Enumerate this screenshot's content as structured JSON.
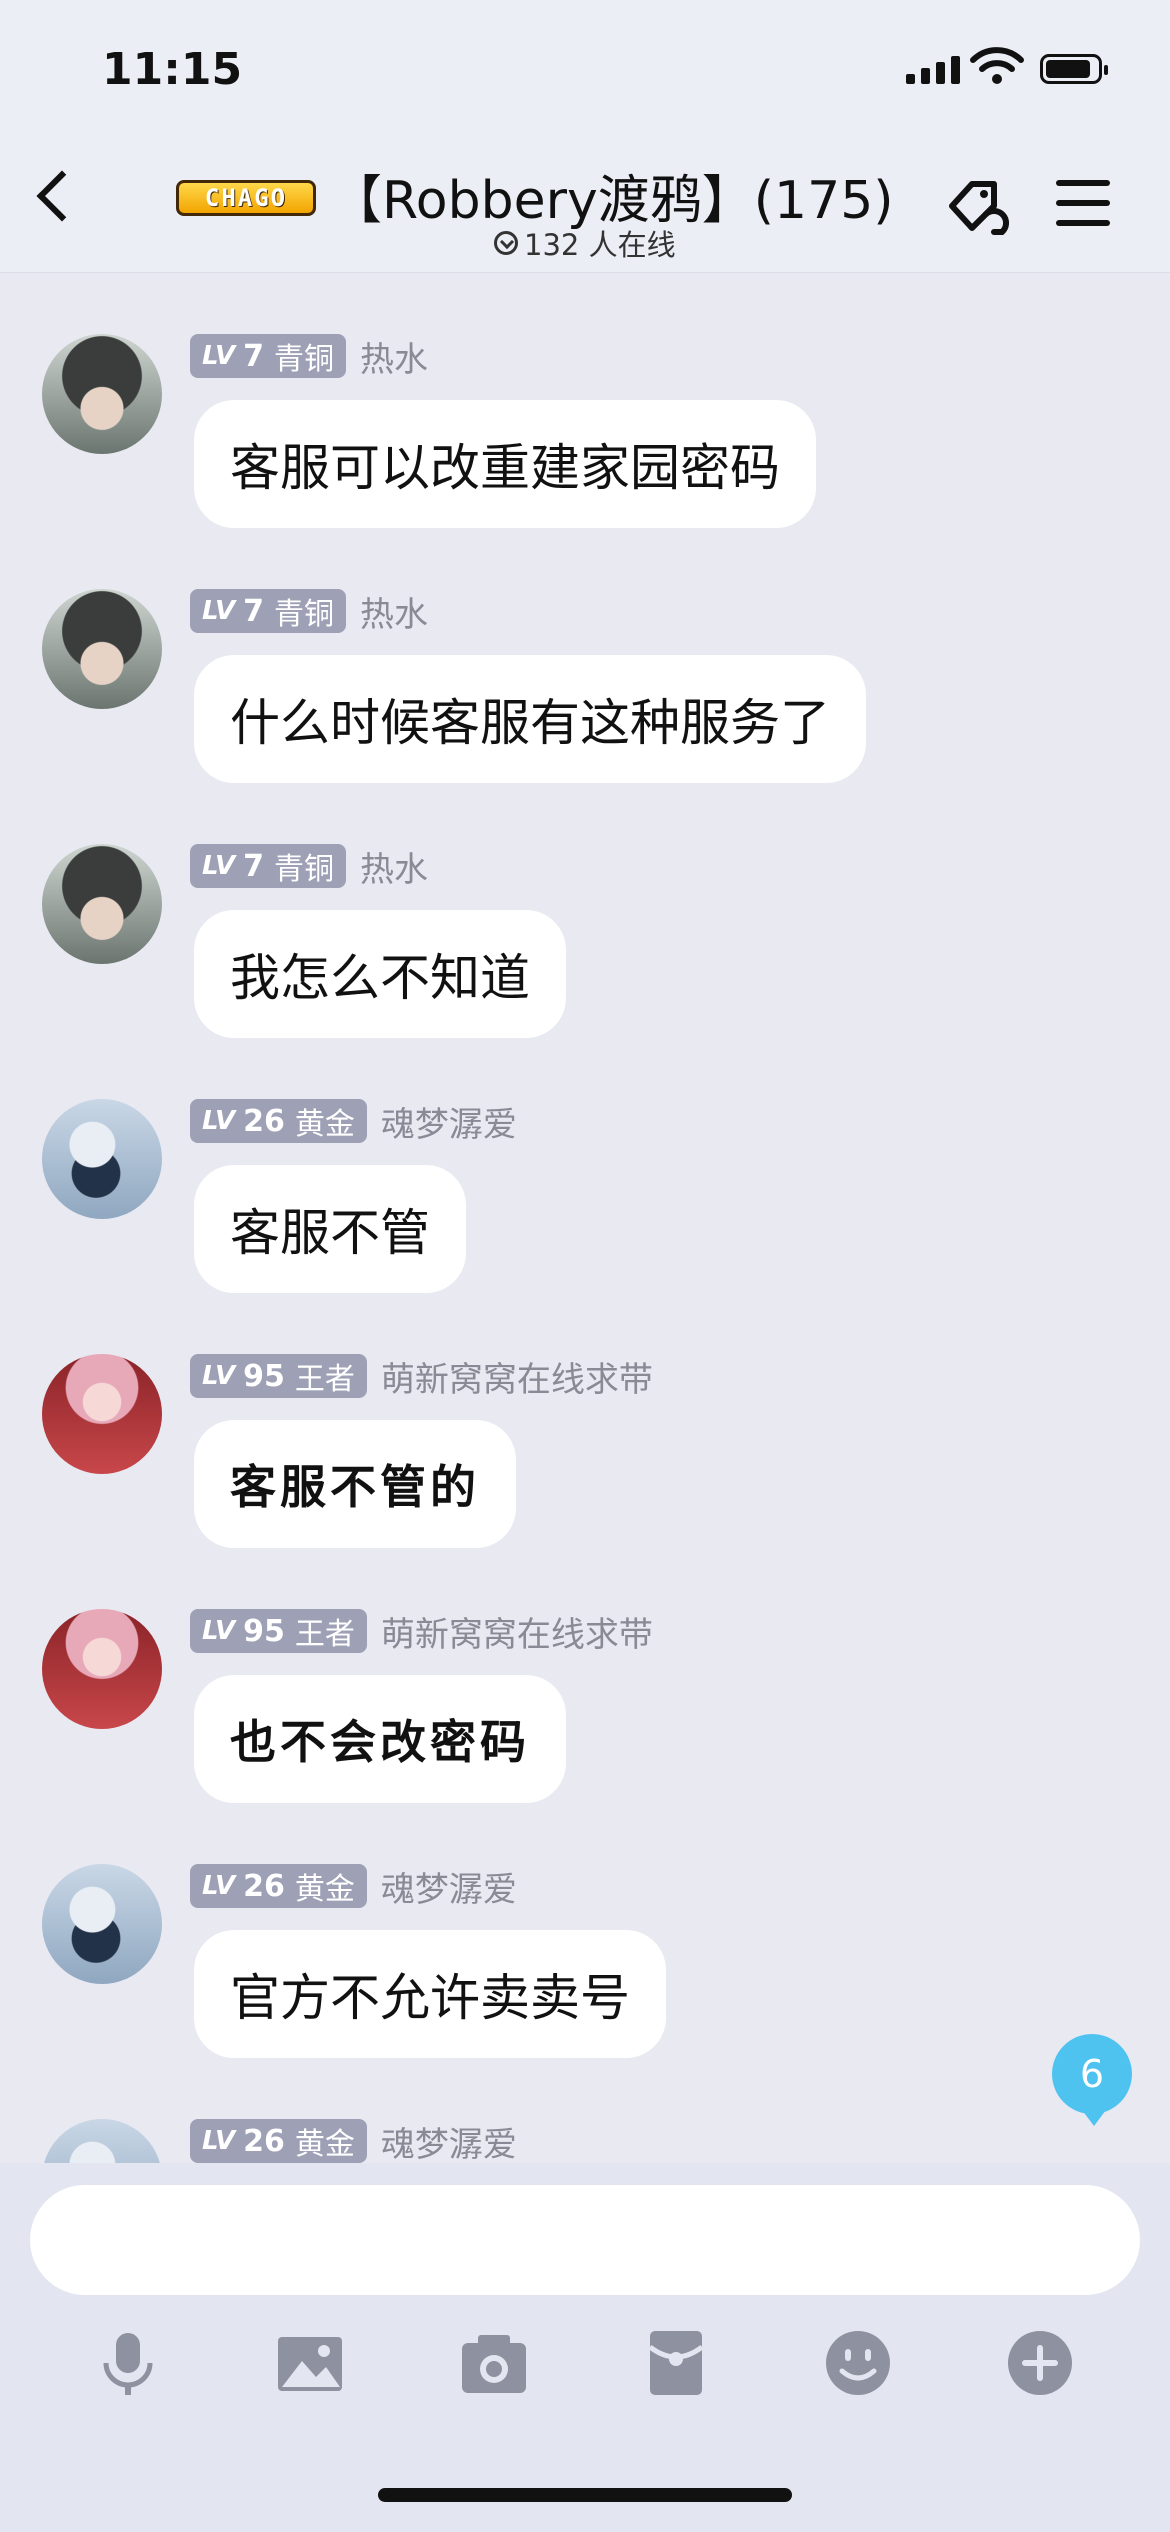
{
  "status_bar": {
    "time": "11:15"
  },
  "header": {
    "logo_text": "CHAGO",
    "title": "【Robbery渡鸦】(175)",
    "online_text": "132 人在线",
    "icons": [
      "back-arrow-icon",
      "tag-link-icon",
      "menu-icon",
      "chevron-down-circle-icon"
    ]
  },
  "messages": [
    {
      "level_prefix": "LV",
      "level": "7",
      "rank": "青铜",
      "nickname": "热水",
      "text": "客服可以改重建家园密码",
      "avatar": "gray-hair-boy"
    },
    {
      "level_prefix": "LV",
      "level": "7",
      "rank": "青铜",
      "nickname": "热水",
      "text": "什么时候客服有这种服务了",
      "avatar": "gray-hair-boy"
    },
    {
      "level_prefix": "LV",
      "level": "7",
      "rank": "青铜",
      "nickname": "热水",
      "text": "我怎么不知道",
      "avatar": "gray-hair-boy"
    },
    {
      "level_prefix": "LV",
      "level": "26",
      "rank": "黄金",
      "nickname": "魂梦潺爱",
      "text": "客服不管",
      "avatar": "masked-ninja"
    },
    {
      "level_prefix": "LV",
      "level": "95",
      "rank": "王者",
      "nickname": "萌新窝窝在线求带",
      "text": "客服不管的",
      "avatar": "pink-hair-girl"
    },
    {
      "level_prefix": "LV",
      "level": "95",
      "rank": "王者",
      "nickname": "萌新窝窝在线求带",
      "text": "也不会改密码",
      "avatar": "pink-hair-girl"
    },
    {
      "level_prefix": "LV",
      "level": "26",
      "rank": "黄金",
      "nickname": "魂梦潺爱",
      "text": "官方不允许卖卖号",
      "avatar": "masked-ninja"
    },
    {
      "level_prefix": "LV",
      "level": "26",
      "rank": "黄金",
      "nickname": "魂梦潺爱",
      "text": "",
      "avatar": "masked-ninja"
    }
  ],
  "unread_count": "6",
  "input": {
    "placeholder": ""
  },
  "toolbar": [
    "microphone-icon",
    "image-icon",
    "camera-icon",
    "red-packet-icon",
    "emoji-icon",
    "plus-icon"
  ],
  "colors": {
    "badge": "#9ea1b6",
    "unread_bubble": "#4fc3f0",
    "background": "#e9e9f2"
  }
}
